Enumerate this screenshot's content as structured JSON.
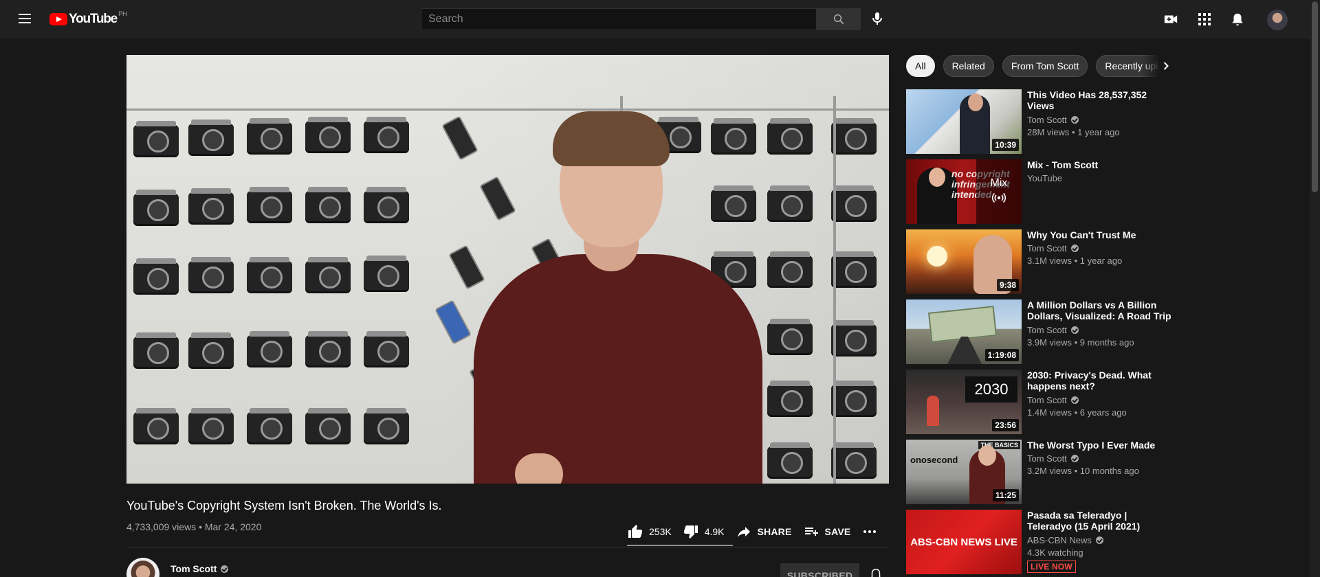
{
  "header": {
    "logo_text": "YouTube",
    "logo_country": "PH",
    "search_placeholder": "Search",
    "icons": [
      "menu-icon",
      "search-icon",
      "mic-icon",
      "create-video-icon",
      "apps-grid-icon",
      "notifications-bell-icon",
      "account-avatar"
    ]
  },
  "video": {
    "title": "YouTube's Copyright System Isn't Broken. The World's Is.",
    "info": "4,733,009 views • Mar 24, 2020",
    "likes": "253K",
    "dislikes": "4.9K",
    "share_label": "SHARE",
    "save_label": "SAVE",
    "channel": "Tom Scott",
    "subscribe_label": "SUBSCRIBED"
  },
  "chips": [
    "All",
    "Related",
    "From Tom Scott",
    "Recently uploaded"
  ],
  "recommendations": [
    {
      "title": "This Video Has 28,537,352 Views",
      "channel": "Tom Scott",
      "verified": true,
      "meta": "28M views • 1 year ago",
      "duration": "10:39"
    },
    {
      "title": "Mix - Tom Scott",
      "channel": "YouTube",
      "verified": false,
      "meta": "",
      "duration": "",
      "overlay": "Mix",
      "thumb_text": "no copyright infringement intended"
    },
    {
      "title": "Why You Can't Trust Me",
      "channel": "Tom Scott",
      "verified": true,
      "meta": "3.1M views • 1 year ago",
      "duration": "9:38"
    },
    {
      "title": "A Million Dollars vs A Billion Dollars, Visualized: A Road Trip",
      "channel": "Tom Scott",
      "verified": true,
      "meta": "3.9M views • 9 months ago",
      "duration": "1:19:08"
    },
    {
      "title": "2030: Privacy's Dead. What happens next?",
      "channel": "Tom Scott",
      "verified": true,
      "meta": "1.4M views • 6 years ago",
      "duration": "23:56",
      "thumb_text": "2030"
    },
    {
      "title": "The Worst Typo I Ever Made",
      "channel": "Tom Scott",
      "verified": true,
      "meta": "3.2M views • 10 months ago",
      "duration": "11:25",
      "thumb_text": "onosecond",
      "thumb_badge": "THE BASICS"
    },
    {
      "title": "Pasada sa Teleradyo | Teleradyo (15 April 2021)",
      "channel": "ABS-CBN News",
      "verified": true,
      "meta": "4.3K watching",
      "duration": "",
      "live_badge": "LIVE NOW",
      "thumb_text": "ABS-CBN NEWS LIVE"
    }
  ],
  "colors": {
    "background": "#181818",
    "header": "#202020",
    "brand_red": "#ff0000",
    "live_red": "#ff4e45",
    "secondary_text": "#aaaaaa"
  }
}
